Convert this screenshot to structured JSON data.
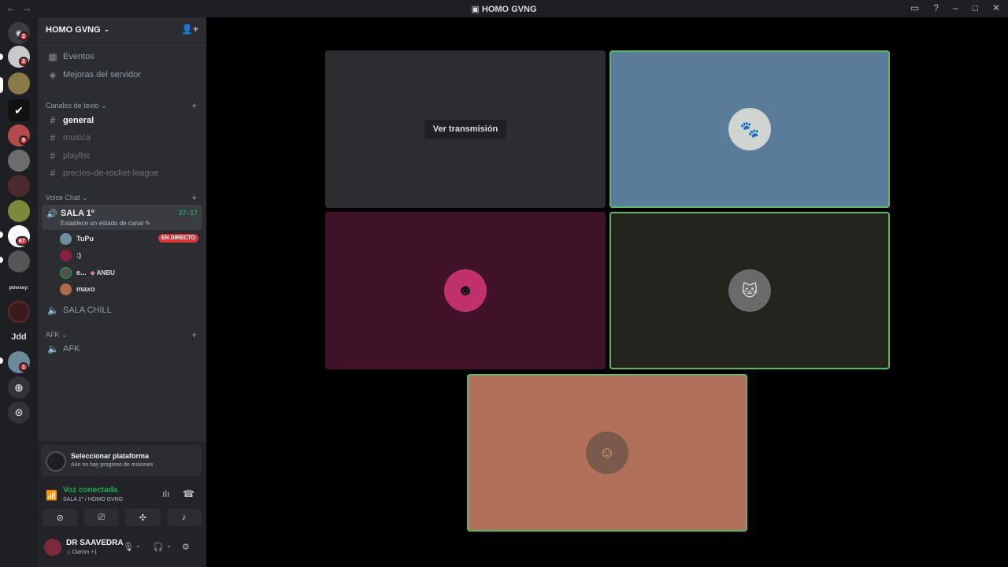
{
  "window": {
    "title": "HOMO GVNG"
  },
  "guilds": {
    "badges": [
      "2",
      "2",
      "5",
      "67",
      "1"
    ],
    "text_labels": [
      "ptnvsey:",
      "Jdd"
    ]
  },
  "server": {
    "name": "HOMO GVNG",
    "top_items": [
      "Eventos",
      "Mejoras del servidor"
    ]
  },
  "categories": {
    "text": "Canales de texto",
    "voice": "Voice Chat",
    "afk": "AFK"
  },
  "text_channels": [
    "general",
    "musica",
    "playlist",
    "precios-de-rocket-league"
  ],
  "voice_channels": {
    "active": {
      "name": "SALA 1º",
      "status": "Establece un estado de canal",
      "timer": "27:17"
    },
    "other": "SALA CHILL",
    "afk": "AFK"
  },
  "members": [
    {
      "name": "TuPu",
      "live": "EN DIRECTO"
    },
    {
      "name": ":)"
    },
    {
      "name": "e...",
      "tag": "ANBU"
    },
    {
      "name": "maxo"
    }
  ],
  "quest": {
    "title": "Seleccionar plataforma",
    "subtitle": "Aún no hay progreso de misiones"
  },
  "voice_connection": {
    "status": "Voz conectada",
    "channel": "SALA 1º / HOMO GVNG"
  },
  "user": {
    "name": "DR SAAVEDRA",
    "activity": "Clarion +1"
  },
  "stage": {
    "watch_label": "Ver transmisión",
    "colors": {
      "tile_blue": "#5b7b9b",
      "tile_maroon": "#3f1228",
      "tile_dark": "#25231d",
      "tile_salmon": "#b1705a",
      "speaking": "#5fb665"
    }
  }
}
